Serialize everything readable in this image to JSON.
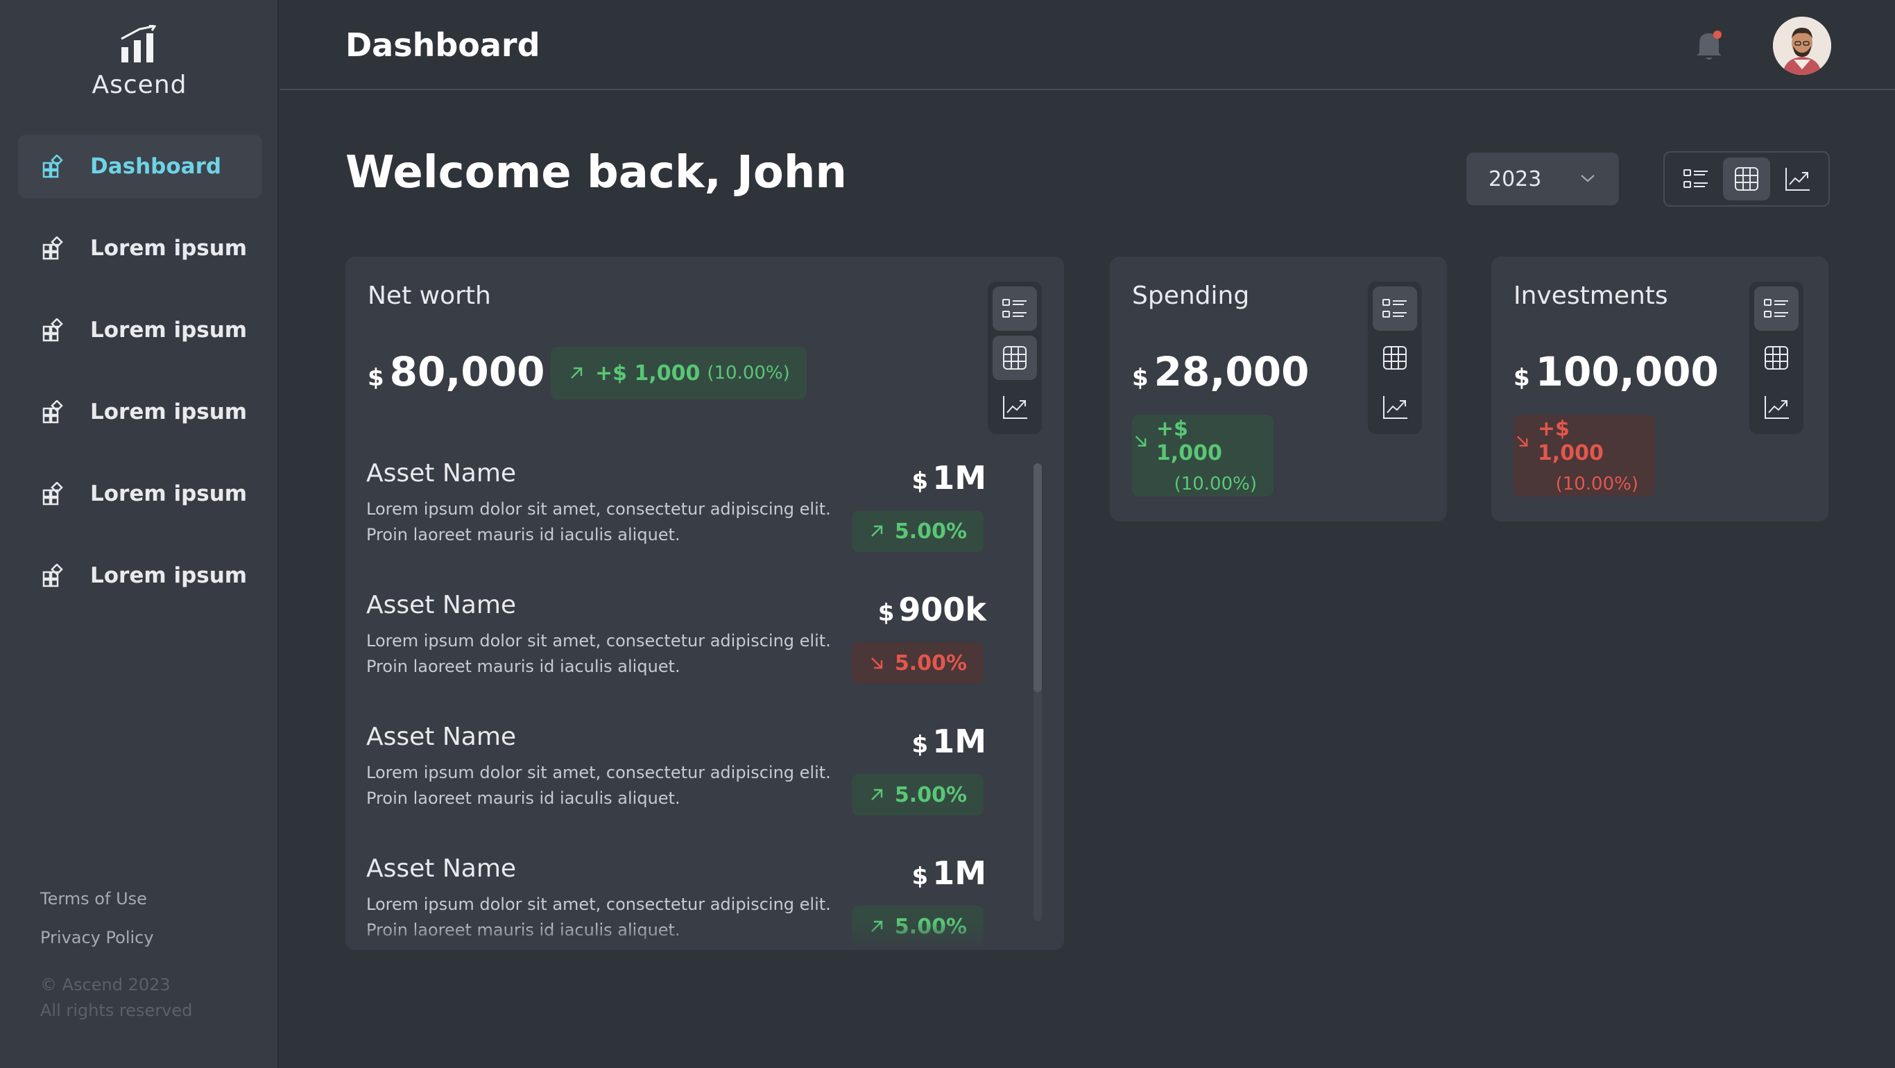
{
  "app": {
    "name": "Ascend"
  },
  "sidebar": {
    "items": [
      {
        "label": "Dashboard",
        "active": true
      },
      {
        "label": "Lorem ipsum"
      },
      {
        "label": "Lorem ipsum"
      },
      {
        "label": "Lorem ipsum"
      },
      {
        "label": "Lorem ipsum"
      },
      {
        "label": "Lorem ipsum"
      }
    ],
    "links": {
      "terms": "Terms of Use",
      "privacy": "Privacy Policy"
    },
    "copyright": {
      "line1": "© Ascend 2023",
      "line2": "All rights reserved"
    }
  },
  "header": {
    "title": "Dashboard",
    "notification_dot_color": "#e2574c"
  },
  "welcome": "Welcome back, John",
  "year_filter": {
    "value": "2023"
  },
  "colors": {
    "accent": "#6fd3e6",
    "positive": "#59c775",
    "negative": "#e2574c"
  },
  "net_worth": {
    "title": "Net worth",
    "currency": "$",
    "amount": "80,000",
    "delta": {
      "value": "+$ 1,000",
      "pct": "(10.00%)",
      "direction": "up"
    },
    "assets": [
      {
        "name": "Asset Name",
        "desc1": "Lorem ipsum dolor sit amet, consectetur adipiscing elit.",
        "desc2": "Proin laoreet mauris id iaculis aliquet.",
        "currency": "$",
        "value": "1M",
        "change": "5.00%",
        "direction": "up"
      },
      {
        "name": "Asset Name",
        "desc1": "Lorem ipsum dolor sit amet, consectetur adipiscing elit.",
        "desc2": "Proin laoreet mauris id iaculis aliquet.",
        "currency": "$",
        "value": "900k",
        "change": "5.00%",
        "direction": "down"
      },
      {
        "name": "Asset Name",
        "desc1": "Lorem ipsum dolor sit amet, consectetur adipiscing elit.",
        "desc2": "Proin laoreet mauris id iaculis aliquet.",
        "currency": "$",
        "value": "1M",
        "change": "5.00%",
        "direction": "up"
      },
      {
        "name": "Asset Name",
        "desc1": "Lorem ipsum dolor sit amet, consectetur adipiscing elit.",
        "desc2": "Proin laoreet mauris id iaculis aliquet.",
        "currency": "$",
        "value": "1M",
        "change": "5.00%",
        "direction": "up"
      }
    ]
  },
  "spending": {
    "title": "Spending",
    "currency": "$",
    "amount": "28,000",
    "delta": {
      "value": "+$ 1,000",
      "pct": "(10.00%)",
      "direction": "down_green"
    }
  },
  "investments": {
    "title": "Investments",
    "currency": "$",
    "amount": "100,000",
    "delta": {
      "value": "+$ 1,000",
      "pct": "(10.00%)",
      "direction": "down"
    }
  }
}
